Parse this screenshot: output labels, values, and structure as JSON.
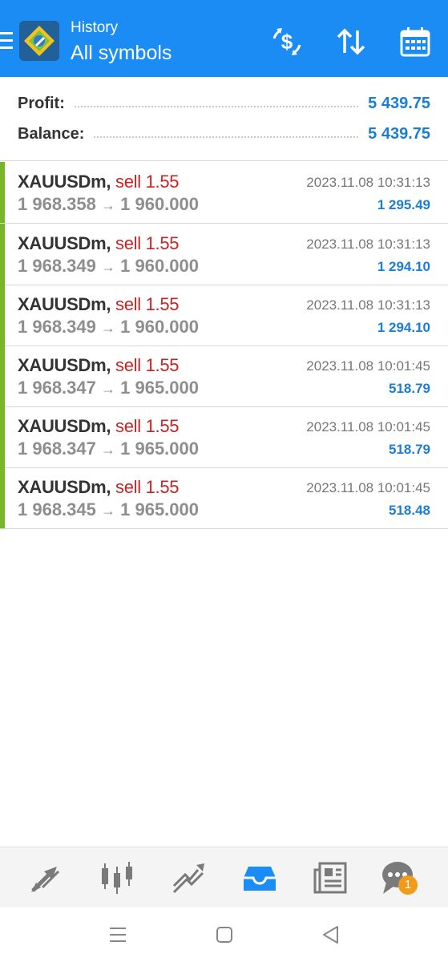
{
  "header": {
    "subtitle": "History",
    "title": "All symbols"
  },
  "summary": {
    "profit_label": "Profit:",
    "profit_value": "5 439.75",
    "balance_label": "Balance:",
    "balance_value": "5 439.75"
  },
  "trades": [
    {
      "symbol": "XAUUSDm,",
      "side": "sell 1.55",
      "open": "1 968.358",
      "arrow": "→",
      "close": "1 960.000",
      "time": "2023.11.08 10:31:13",
      "profit": "1 295.49"
    },
    {
      "symbol": "XAUUSDm,",
      "side": "sell 1.55",
      "open": "1 968.349",
      "arrow": "→",
      "close": "1 960.000",
      "time": "2023.11.08 10:31:13",
      "profit": "1 294.10"
    },
    {
      "symbol": "XAUUSDm,",
      "side": "sell 1.55",
      "open": "1 968.349",
      "arrow": "→",
      "close": "1 960.000",
      "time": "2023.11.08 10:31:13",
      "profit": "1 294.10"
    },
    {
      "symbol": "XAUUSDm,",
      "side": "sell 1.55",
      "open": "1 968.347",
      "arrow": "→",
      "close": "1 965.000",
      "time": "2023.11.08 10:01:45",
      "profit": "518.79"
    },
    {
      "symbol": "XAUUSDm,",
      "side": "sell 1.55",
      "open": "1 968.347",
      "arrow": "→",
      "close": "1 965.000",
      "time": "2023.11.08 10:01:45",
      "profit": "518.79"
    },
    {
      "symbol": "XAUUSDm,",
      "side": "sell 1.55",
      "open": "1 968.345",
      "arrow": "→",
      "close": "1 965.000",
      "time": "2023.11.08 10:01:45",
      "profit": "518.48"
    }
  ],
  "nav": {
    "tabs": [
      "quotes-icon",
      "chart-icon",
      "trade-icon",
      "history-icon",
      "news-icon",
      "messages-icon"
    ],
    "active": "history-icon",
    "badge": "1"
  },
  "colors": {
    "accent": "#1a8cf3",
    "sell": "#c62424",
    "profit": "#1a7fd4",
    "bar": "#79b42a",
    "badge": "#f29a1b"
  }
}
